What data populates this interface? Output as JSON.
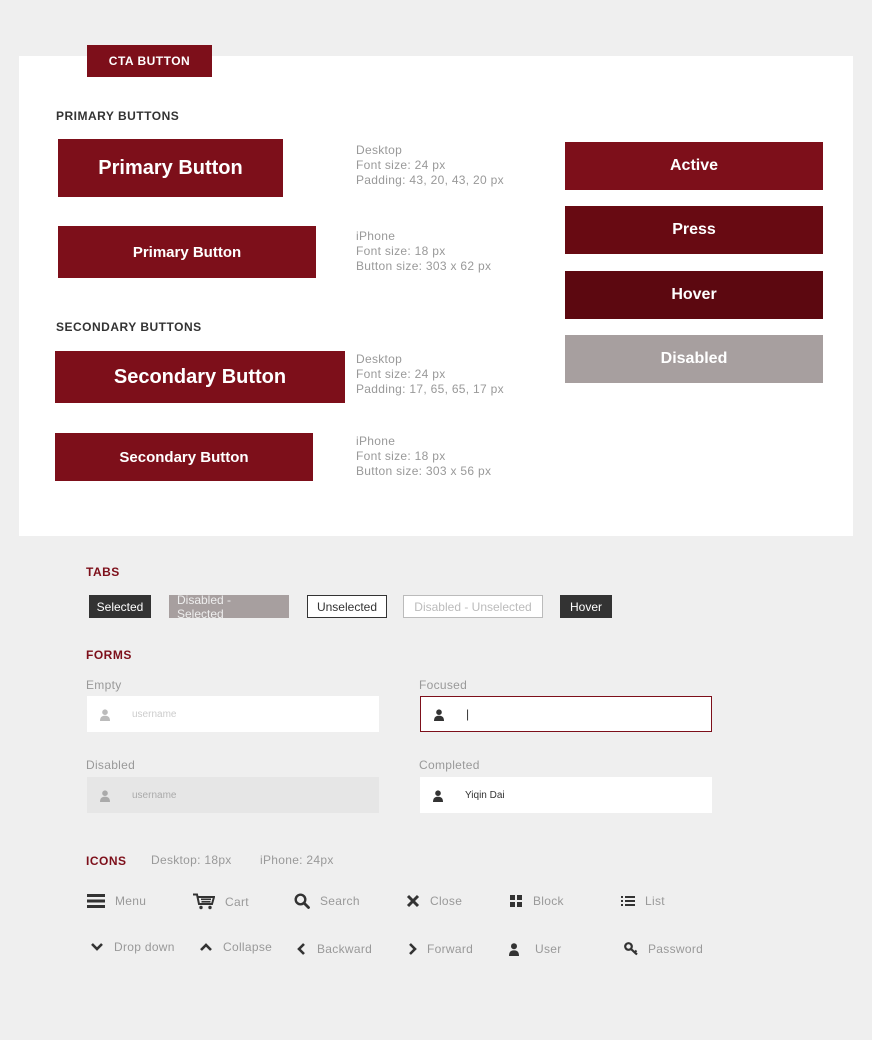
{
  "cta": {
    "label": "CTA BUTTON"
  },
  "primary": {
    "heading": "PRIMARY BUTTONS",
    "desktop_button": "Primary Button",
    "iphone_button": "Primary Button",
    "desktop_spec": {
      "device": "Desktop",
      "font": "Font size: 24 px",
      "size": "Padding: 43, 20, 43, 20 px"
    },
    "iphone_spec": {
      "device": "iPhone",
      "font": "Font size: 18 px",
      "size": "Button size: 303 x 62 px"
    }
  },
  "secondary": {
    "heading": "SECONDARY BUTTONS",
    "desktop_button": "Secondary Button",
    "iphone_button": "Secondary Button",
    "desktop_spec": {
      "device": "Desktop",
      "font": "Font size: 24 px",
      "size": "Padding: 17, 65, 65, 17 px"
    },
    "iphone_spec": {
      "device": "iPhone",
      "font": "Font size: 18 px",
      "size": "Button size: 303 x 56 px"
    }
  },
  "states": {
    "active": "Active",
    "press": "Press",
    "hover": "Hover",
    "disabled": "Disabled"
  },
  "colors": {
    "brand": "#7d0f1a",
    "press": "#680a12",
    "hover": "#5c0810",
    "disabled": "#a79f9f",
    "dark": "#333333"
  },
  "tabs": {
    "heading": "TABS",
    "selected": "Selected",
    "disabled_selected": "Disabled - Selected",
    "unselected": "Unselected",
    "disabled_unselected": "Disabled - Unselected",
    "hover": "Hover"
  },
  "forms": {
    "heading": "FORMS",
    "empty_label": "Empty",
    "empty_placeholder": "username",
    "focused_label": "Focused",
    "focused_value": "|",
    "disabled_label": "Disabled",
    "disabled_placeholder": "username",
    "completed_label": "Completed",
    "completed_value": "Yiqin Dai"
  },
  "icons": {
    "heading": "ICONS",
    "desktop_size": "Desktop: 18px",
    "iphone_size": "iPhone: 24px",
    "items": {
      "menu": "Menu",
      "cart": "Cart",
      "search": "Search",
      "close": "Close",
      "block": "Block",
      "list": "List",
      "dropdown": "Drop down",
      "collapse": "Collapse",
      "backward": "Backward",
      "forward": "Forward",
      "user": "User",
      "password": "Password"
    }
  }
}
